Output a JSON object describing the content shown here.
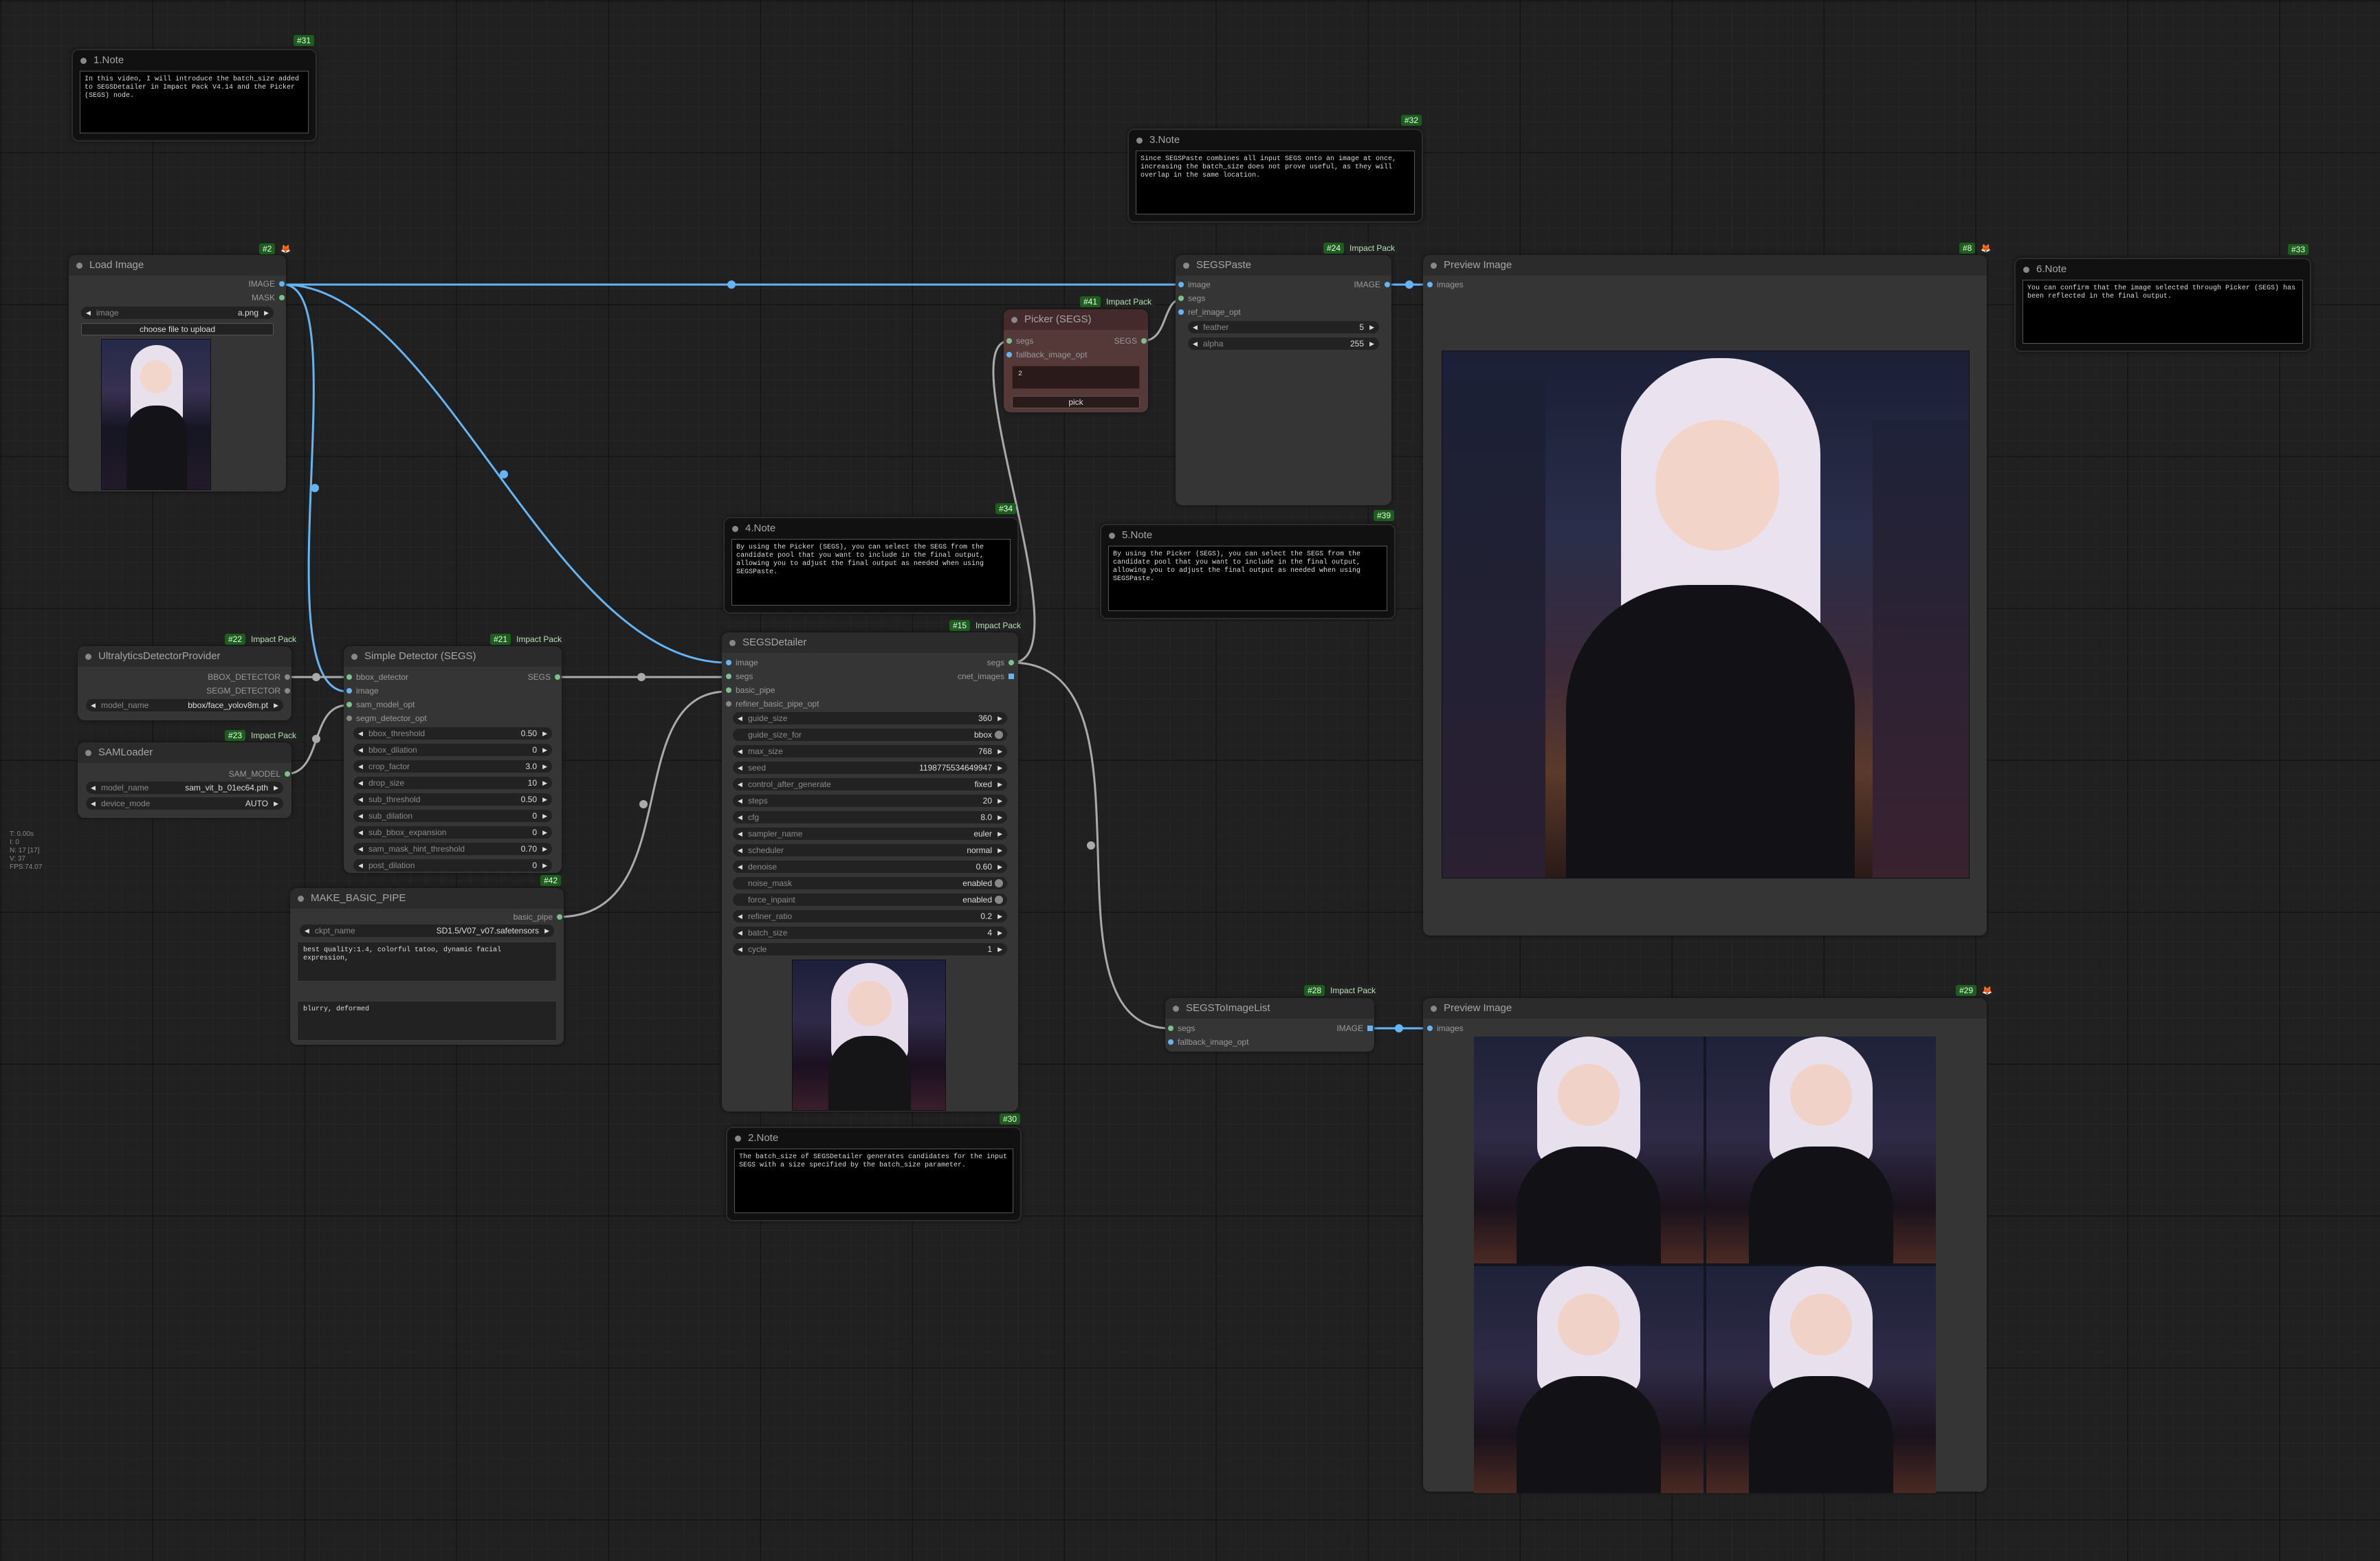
{
  "stats": [
    "T: 0.00s",
    "I: 0",
    "N: 17 [17]",
    "V: 37",
    "FPS:74.07"
  ],
  "notes": {
    "n1": {
      "title": "1.Note",
      "id": "#31",
      "text": "In this video, I will introduce the batch_size added to SEGSDetailer in Impact Pack V4.14 and the Picker (SEGS) node."
    },
    "n2": {
      "title": "2.Note",
      "id": "#30",
      "text": "The batch_size of SEGSDetailer generates candidates for the input SEGS with a size specified by the batch_size parameter."
    },
    "n3": {
      "title": "3.Note",
      "id": "#32",
      "text": "Since SEGSPaste combines all input SEGS onto an image at once, increasing the batch_size does not prove useful, as they will overlap in the same location."
    },
    "n4": {
      "title": "4.Note",
      "id": "#34",
      "text": "By using the Picker (SEGS), you can select the SEGS from the candidate pool that you want to include in the final output, allowing you to adjust the final output as needed when using SEGSPaste."
    },
    "n5": {
      "title": "5.Note",
      "id": "#39",
      "text": "By using the Picker (SEGS), you can select the SEGS from the candidate pool that you want to include in the final output, allowing you to adjust the final output as needed when using SEGSPaste."
    },
    "n6": {
      "title": "6.Note",
      "id": "#33",
      "text": "You can confirm that the image selected through Picker (SEGS) has been reflected in the final output."
    }
  },
  "load": {
    "title": "Load Image",
    "id": "#2",
    "out": [
      "IMAGE",
      "MASK"
    ],
    "image_label": "image",
    "image_value": "a.png",
    "upload": "choose file to upload"
  },
  "ultra": {
    "title": "UltralyticsDetectorProvider",
    "id": "#22",
    "pack": "Impact Pack",
    "out": [
      "BBOX_DETECTOR",
      "SEGM_DETECTOR"
    ],
    "model_label": "model_name",
    "model_value": "bbox/face_yolov8m.pt"
  },
  "sam": {
    "title": "SAMLoader",
    "id": "#23",
    "pack": "Impact Pack",
    "out": "SAM_MODEL",
    "w": [
      {
        "k": "model_name",
        "v": "sam_vit_b_01ec64.pth"
      },
      {
        "k": "device_mode",
        "v": "AUTO"
      }
    ]
  },
  "simple": {
    "title": "Simple Detector (SEGS)",
    "id": "#21",
    "pack": "Impact Pack",
    "in": [
      "bbox_detector",
      "image",
      "sam_model_opt",
      "segm_detector_opt"
    ],
    "out": "SEGS",
    "w": [
      {
        "k": "bbox_threshold",
        "v": "0.50"
      },
      {
        "k": "bbox_dilation",
        "v": "0"
      },
      {
        "k": "crop_factor",
        "v": "3.0"
      },
      {
        "k": "drop_size",
        "v": "10"
      },
      {
        "k": "sub_threshold",
        "v": "0.50"
      },
      {
        "k": "sub_dilation",
        "v": "0"
      },
      {
        "k": "sub_bbox_expansion",
        "v": "0"
      },
      {
        "k": "sam_mask_hint_threshold",
        "v": "0.70"
      },
      {
        "k": "post_dilation",
        "v": "0"
      }
    ]
  },
  "pipe": {
    "title": "MAKE_BASIC_PIPE",
    "id": "#42",
    "out": "basic_pipe",
    "ckpt_label": "ckpt_name",
    "ckpt_value": "SD1.5/V07_v07.safetensors",
    "pos": "best quality:1.4, colorful tatoo, dynamic facial expression,",
    "neg": "blurry, deformed"
  },
  "detailer": {
    "title": "SEGSDetailer",
    "id": "#15",
    "pack": "Impact Pack",
    "in": [
      "image",
      "segs",
      "basic_pipe",
      "refiner_basic_pipe_opt"
    ],
    "out": [
      "segs",
      "cnet_images"
    ],
    "w": [
      {
        "k": "guide_size",
        "v": "360"
      },
      {
        "k": "guide_size_for",
        "v": "bbox",
        "t": 1
      },
      {
        "k": "max_size",
        "v": "768"
      },
      {
        "k": "seed",
        "v": "1198775534649947"
      },
      {
        "k": "control_after_generate",
        "v": "fixed"
      },
      {
        "k": "steps",
        "v": "20"
      },
      {
        "k": "cfg",
        "v": "8.0"
      },
      {
        "k": "sampler_name",
        "v": "euler"
      },
      {
        "k": "scheduler",
        "v": "normal"
      },
      {
        "k": "denoise",
        "v": "0.60"
      },
      {
        "k": "noise_mask",
        "v": "enabled",
        "t": 1
      },
      {
        "k": "force_inpaint",
        "v": "enabled",
        "t": 1
      },
      {
        "k": "refiner_ratio",
        "v": "0.2"
      },
      {
        "k": "batch_size",
        "v": "4"
      },
      {
        "k": "cycle",
        "v": "1"
      }
    ]
  },
  "picker": {
    "title": "Picker (SEGS)",
    "id": "#41",
    "pack": "Impact Pack",
    "in": [
      "segs",
      "fallback_image_opt"
    ],
    "out": "SEGS",
    "text": "2",
    "btn": "pick"
  },
  "paste": {
    "title": "SEGSPaste",
    "id": "#24",
    "pack": "Impact Pack",
    "in": [
      "image",
      "segs",
      "ref_image_opt"
    ],
    "out": "IMAGE",
    "w": [
      {
        "k": "feather",
        "v": "5"
      },
      {
        "k": "alpha",
        "v": "255"
      }
    ]
  },
  "preview1": {
    "title": "Preview Image",
    "id": "#8",
    "in": "images"
  },
  "toimg": {
    "title": "SEGSToImageList",
    "id": "#28",
    "pack": "Impact Pack",
    "in": [
      "segs",
      "fallback_image_opt"
    ],
    "out": "IMAGE"
  },
  "preview2": {
    "title": "Preview Image",
    "id": "#29",
    "in": "images"
  },
  "colors": {
    "image_wire": "#64b5f6",
    "generic_wire": "#aaaaaa",
    "badge_green": "#1d5d1d"
  }
}
